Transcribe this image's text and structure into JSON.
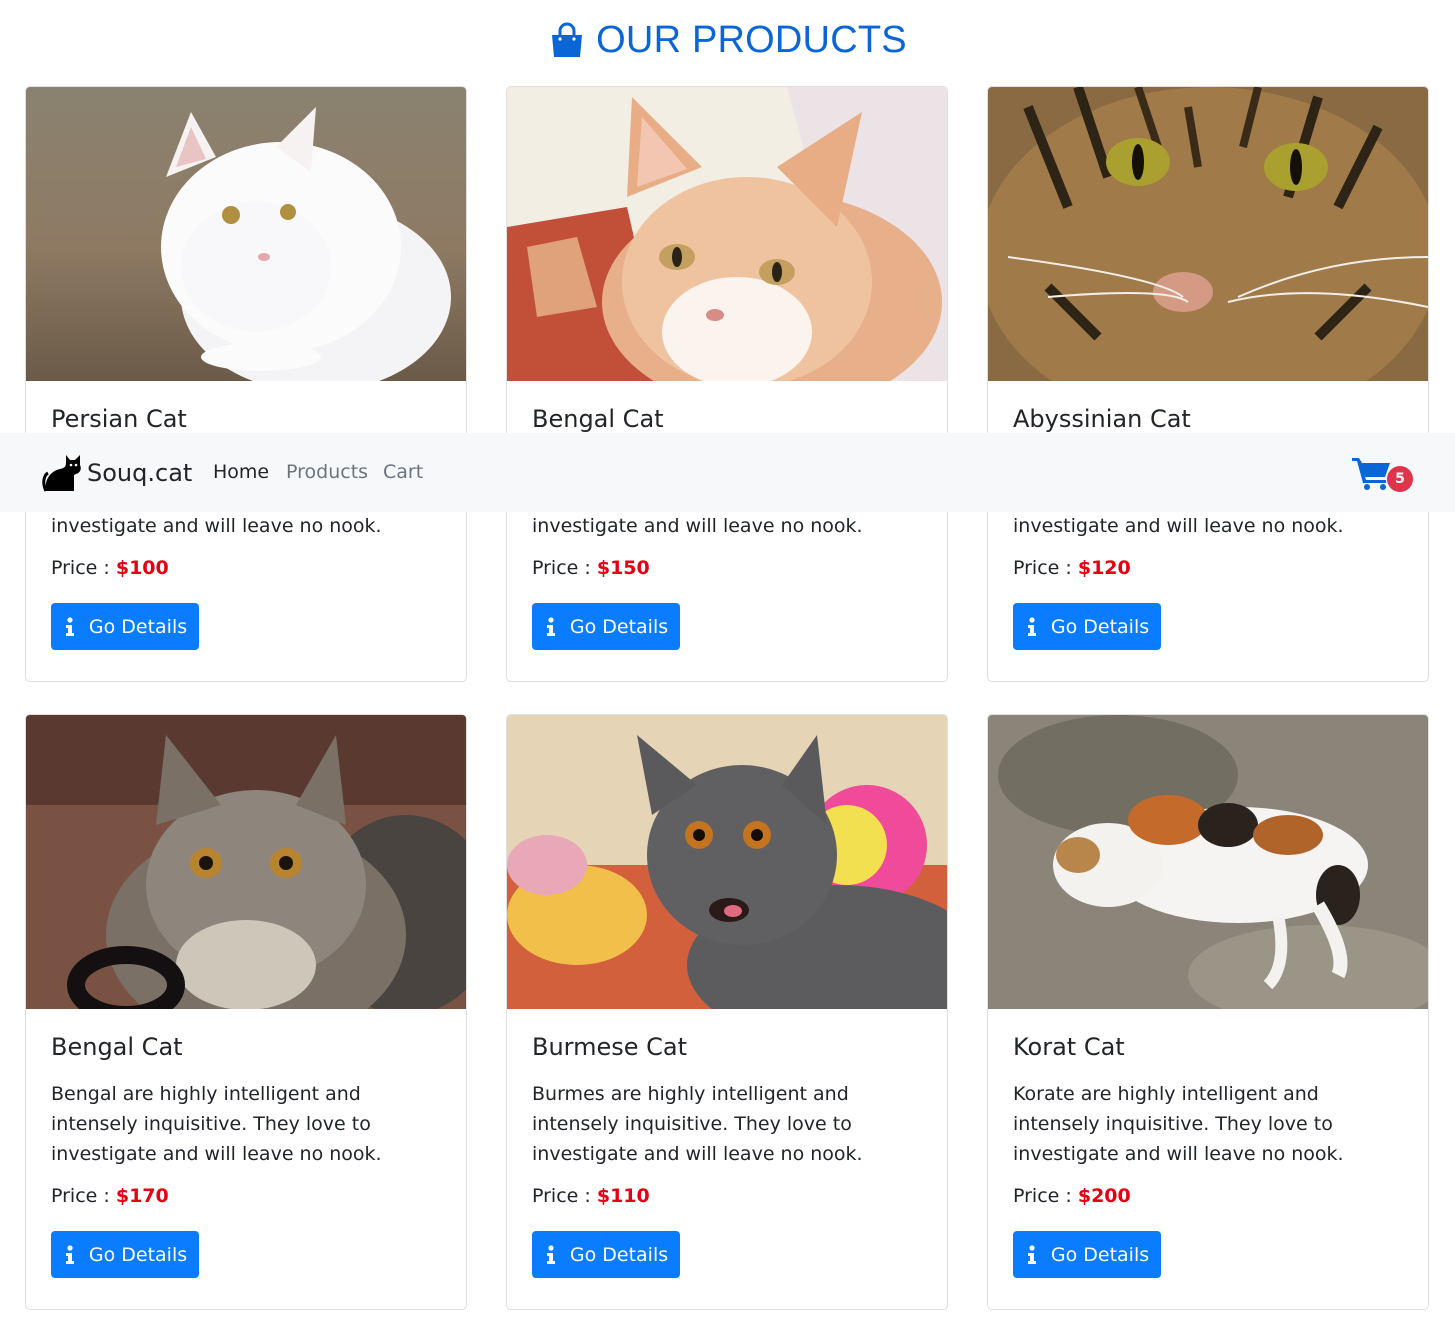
{
  "page": {
    "heading": "OUR PRODUCTS",
    "heading_icon": "shopping-bag-icon",
    "accent_color": "#0a66d6",
    "button_color": "#0a7cff",
    "price_color": "#e60012"
  },
  "navbar": {
    "brand_icon": "cat-icon",
    "brand": "Souq.cat",
    "links": [
      {
        "label": "Home",
        "active": true
      },
      {
        "label": "Products",
        "active": false
      },
      {
        "label": "Cart",
        "active": false
      }
    ],
    "cart_icon": "shopping-cart-icon",
    "cart_count": "5"
  },
  "products": [
    {
      "title": "Persian Cat",
      "description": "Persian are highly intelligent and intensely inquisitive. They love to investigate and will leave no nook.",
      "price_label": "Price :",
      "price": "$100",
      "button_label": "Go Details",
      "button_icon": "info-icon"
    },
    {
      "title": "Bengal Cat",
      "description": "Bengal are highly intelligent and intensely inquisitive. They love to investigate and will leave no nook.",
      "price_label": "Price :",
      "price": "$150",
      "button_label": "Go Details",
      "button_icon": "info-icon"
    },
    {
      "title": "Abyssinian Cat",
      "description": "Abyssinian are highly intelligent and intensely inquisitive. They love to investigate and will leave no nook.",
      "price_label": "Price :",
      "price": "$120",
      "button_label": "Go Details",
      "button_icon": "info-icon"
    },
    {
      "title": "Bengal Cat",
      "description": "Bengal are highly intelligent and intensely inquisitive. They love to investigate and will leave no nook.",
      "price_label": "Price :",
      "price": "$170",
      "button_label": "Go Details",
      "button_icon": "info-icon"
    },
    {
      "title": "Burmese Cat",
      "description": "Burmes are highly intelligent and intensely inquisitive. They love to investigate and will leave no nook.",
      "price_label": "Price :",
      "price": "$110",
      "button_label": "Go Details",
      "button_icon": "info-icon"
    },
    {
      "title": "Korat Cat",
      "description": "Korate are highly intelligent and intensely inquisitive. They love to investigate and will leave no nook.",
      "price_label": "Price :",
      "price": "$200",
      "button_label": "Go Details",
      "button_icon": "info-icon"
    }
  ]
}
